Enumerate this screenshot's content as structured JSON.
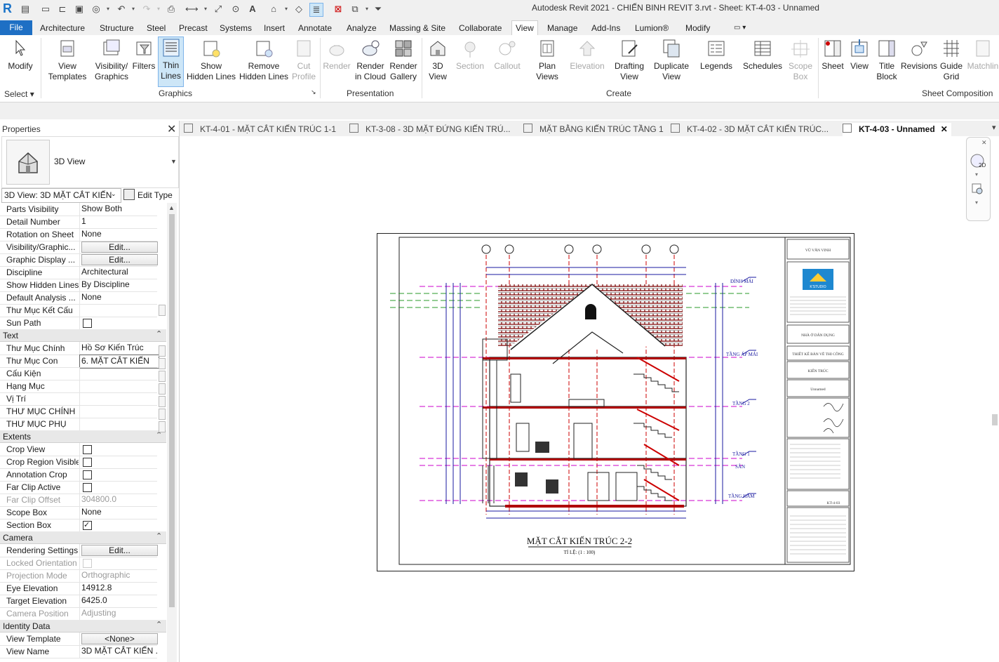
{
  "window_title": "Autodesk Revit 2021 - CHIẾN BINH REVIT 3.rvt - Sheet: KT-4-03 - Unnamed",
  "app_logo": "R",
  "ribbon_tabs": [
    "File",
    "Architecture",
    "Structure",
    "Steel",
    "Precast",
    "Systems",
    "Insert",
    "Annotate",
    "Analyze",
    "Massing & Site",
    "Collaborate",
    "View",
    "Manage",
    "Add-Ins",
    "Lumion®",
    "Modify"
  ],
  "active_tab": "View",
  "ribbon": {
    "modify": "Modify",
    "view_templates": [
      "View",
      "Templates"
    ],
    "visibility_graphics": [
      "Visibility/",
      "Graphics"
    ],
    "filters": "Filters",
    "thin_lines": [
      "Thin",
      "Lines"
    ],
    "show_hidden_lines": [
      "Show",
      "Hidden Lines"
    ],
    "remove_hidden_lines": [
      "Remove",
      "Hidden Lines"
    ],
    "cut_profile": [
      "Cut",
      "Profile"
    ],
    "render": "Render",
    "render_in_cloud": [
      "Render",
      "in Cloud"
    ],
    "render_gallery": [
      "Render",
      "Gallery"
    ],
    "view_3d": [
      "3D",
      "View"
    ],
    "section": "Section",
    "callout": "Callout",
    "plan_views": [
      "Plan",
      "Views"
    ],
    "elevation": "Elevation",
    "drafting_view": [
      "Drafting",
      "View"
    ],
    "duplicate_view": [
      "Duplicate",
      "View"
    ],
    "legends": "Legends",
    "schedules": "Schedules",
    "scope_box": [
      "Scope",
      "Box"
    ],
    "sheet": "Sheet",
    "view": "View",
    "title_block": [
      "Title",
      "Block"
    ],
    "revisions": "Revisions",
    "guide_grid": [
      "Guide",
      "Grid"
    ],
    "matchline": "Matchlin",
    "panels": {
      "select": "Select",
      "graphics": "Graphics",
      "presentation": "Presentation",
      "create": "Create",
      "sheet_composition": "Sheet Composition"
    }
  },
  "properties": {
    "title": "Properties",
    "type_name": "3D View",
    "instance_selector": "3D View: 3D MẶT CẮT KIẾN",
    "edit_type": "Edit Type",
    "rows": [
      {
        "name": "Parts Visibility",
        "value": "Show Both"
      },
      {
        "name": "Detail Number",
        "value": "1"
      },
      {
        "name": "Rotation on Sheet",
        "value": "None"
      },
      {
        "name": "Visibility/Graphic...",
        "value": "Edit...",
        "kind": "button"
      },
      {
        "name": "Graphic Display ...",
        "value": "Edit...",
        "kind": "button"
      },
      {
        "name": "Discipline",
        "value": "Architectural"
      },
      {
        "name": "Show Hidden Lines",
        "value": "By Discipline"
      },
      {
        "name": "Default Analysis ...",
        "value": "None"
      },
      {
        "name": "Thư Mục Kết Cấu",
        "value": ""
      },
      {
        "name": "Sun Path",
        "value": "",
        "kind": "check",
        "checked": false
      },
      {
        "group": "Text"
      },
      {
        "name": "Thư Mục Chính",
        "value": "Hồ Sơ Kiến Trúc"
      },
      {
        "name": "Thư Mục Con",
        "value": "6. MẶT CẮT KIẾN",
        "kind": "boxed"
      },
      {
        "name": "Cấu Kiện",
        "value": ""
      },
      {
        "name": "Hạng Mục",
        "value": ""
      },
      {
        "name": "Vị Trí",
        "value": ""
      },
      {
        "name": "THƯ MỤC CHÍNH",
        "value": ""
      },
      {
        "name": "THƯ MỤC PHỤ",
        "value": ""
      },
      {
        "group": "Extents"
      },
      {
        "name": "Crop View",
        "value": "",
        "kind": "check",
        "checked": false
      },
      {
        "name": "Crop Region Visible",
        "value": "",
        "kind": "check",
        "checked": false
      },
      {
        "name": "Annotation Crop",
        "value": "",
        "kind": "check",
        "checked": false
      },
      {
        "name": "Far Clip Active",
        "value": "",
        "kind": "check",
        "checked": false
      },
      {
        "name": "Far Clip Offset",
        "value": "304800.0",
        "grey": true
      },
      {
        "name": "Scope Box",
        "value": "None"
      },
      {
        "name": "Section Box",
        "value": "",
        "kind": "check",
        "checked": true
      },
      {
        "group": "Camera"
      },
      {
        "name": "Rendering Settings",
        "value": "Edit...",
        "kind": "button"
      },
      {
        "name": "Locked Orientation",
        "value": "",
        "kind": "check",
        "checked": false,
        "grey": true
      },
      {
        "name": "Projection Mode",
        "value": "Orthographic",
        "grey": true
      },
      {
        "name": "Eye Elevation",
        "value": "14912.8"
      },
      {
        "name": "Target Elevation",
        "value": "6425.0"
      },
      {
        "name": "Camera Position",
        "value": "Adjusting",
        "grey": true
      },
      {
        "group": "Identity Data"
      },
      {
        "name": "View Template",
        "value": "<None>",
        "kind": "button"
      },
      {
        "name": "View Name",
        "value": "3D MẶT CẮT KIẾN ..."
      }
    ]
  },
  "doc_tabs": [
    {
      "label": "KT-4-01 - MẶT CẮT KIẾN TRÚC 1-1",
      "active": false
    },
    {
      "label": "KT-3-08 - 3D MẶT ĐỨNG KIẾN TRÚ...",
      "active": false
    },
    {
      "label": "MẶT BẰNG KIẾN TRÚC TẦNG 1",
      "active": false
    },
    {
      "label": "KT-4-02 - 3D MẶT CẮT KIẾN TRÚC...",
      "active": false
    },
    {
      "label": "KT-4-03 - Unnamed",
      "active": true
    }
  ],
  "sheet": {
    "view_title": "MẶT CẮT KIẾN TRÚC 2-2",
    "scale": "TỈ LỆ: (1 : 100)",
    "level_labels": [
      "ĐỈNH MÁI",
      "TẦNG ÁP MÁI",
      "TẦNG 2",
      "TẦNG 1",
      "SÂN",
      "TẦNG HẦM"
    ],
    "titleblock": {
      "designer": "VŨ VĂN VINH",
      "company": "K'STUDIO",
      "project": "NHÀ Ở DÂN DỤNG",
      "phase": "THIẾT KẾ BẢN VẼ THI CÔNG",
      "discipline": "KIẾN TRÚC",
      "sheet_name": "Unnamed",
      "sheet_number": "KT-4-03"
    }
  },
  "colors": {
    "accent": "#1e6fc4",
    "tab_bg": "#f0f0f0",
    "selected_btn": "#cde6f7",
    "hatch": "#8b0000",
    "stair": "#cc0000"
  }
}
